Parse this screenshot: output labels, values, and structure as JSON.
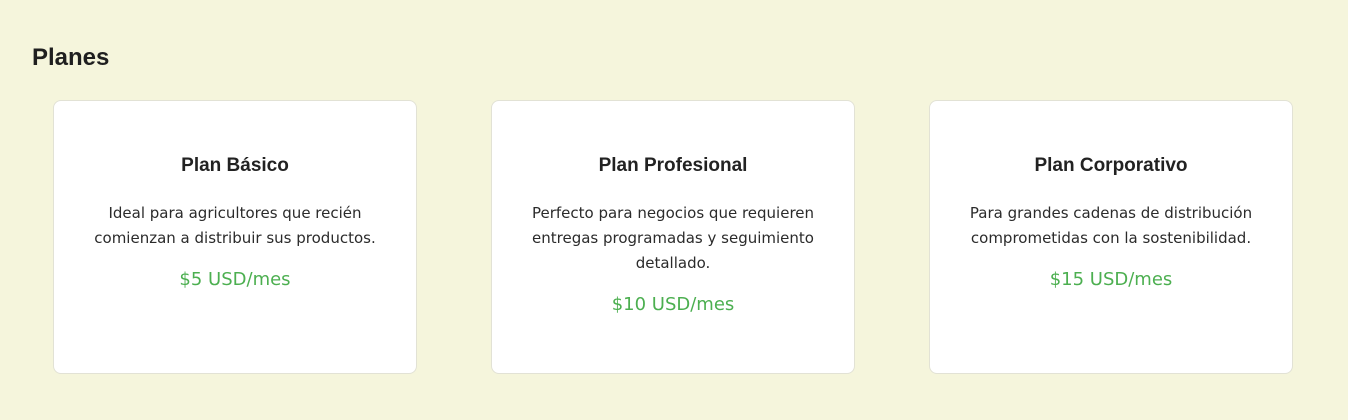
{
  "section": {
    "title": "Planes"
  },
  "plans": [
    {
      "title": "Plan Básico",
      "description": "Ideal para agricultores que recién comienzan a distribuir sus productos.",
      "price": "$5 USD/mes"
    },
    {
      "title": "Plan Profesional",
      "description": "Perfecto para negocios que requieren entregas programadas y seguimiento detallado.",
      "price": "$10 USD/mes"
    },
    {
      "title": "Plan Corporativo",
      "description": "Para grandes cadenas de distribución comprometidas con la sostenibilidad.",
      "price": "$15 USD/mes"
    }
  ],
  "colors": {
    "background": "#f5f5dc",
    "card_background": "#ffffff",
    "price": "#4caf50",
    "text": "#222222"
  }
}
